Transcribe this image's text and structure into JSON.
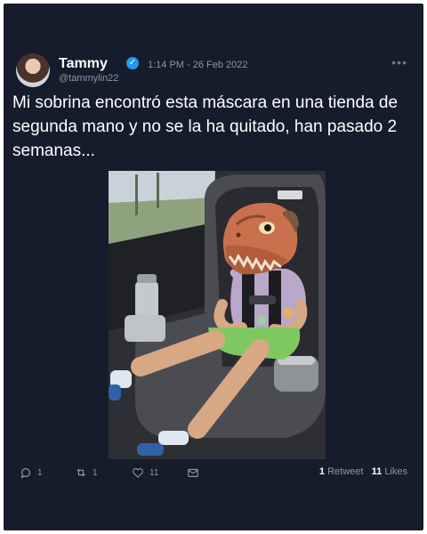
{
  "tweet": {
    "author_name": "Tammy",
    "handle": "@tammylin22",
    "timestamp": "1:14 PM - 26 Feb 2022",
    "more_label": "•••",
    "text": "Mi sobrina encontró esta máscara en una tienda de segunda mano y no se la ha quitado, han pasado 2 semanas...",
    "verified_mark": "✓"
  },
  "actions": {
    "reply_count": "1",
    "retweet_count": "1",
    "like_count": "11"
  },
  "stats": {
    "retweets_num": "1",
    "retweets_label": "Retweet",
    "likes_num": "11",
    "likes_label": "Likes"
  },
  "colors": {
    "background": "#151c2b",
    "verified": "#1d9bf0",
    "muted": "#8b98a5"
  }
}
